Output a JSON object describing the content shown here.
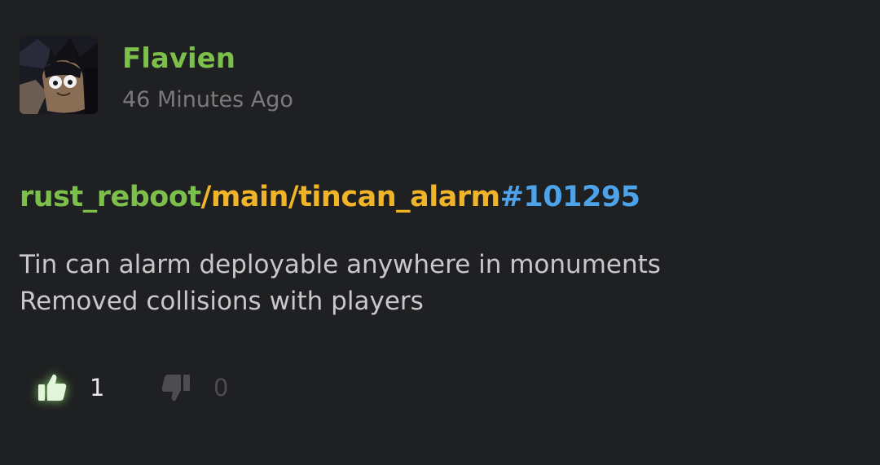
{
  "post": {
    "author": "Flavien",
    "timestamp": "46 Minutes Ago",
    "avatar_icon": "cartoon-avatar-icon",
    "commit": {
      "repo": "rust_reboot",
      "branch": "/main/tincan_alarm",
      "changeset": "#101295"
    },
    "message_lines": [
      "Tin can alarm deployable anywhere in monuments",
      "Removed collisions with players"
    ],
    "votes": {
      "up_icon": "thumbs-up-icon",
      "up_count": "1",
      "down_icon": "thumbs-down-icon",
      "down_count": "0"
    }
  },
  "colors": {
    "background": "#1f2022",
    "author": "#7cbf4a",
    "repo": "#7cbf4a",
    "branch": "#f0b429",
    "changeset": "#4da3ea",
    "message": "#c8c8ca",
    "timestamp": "#7a7a7c",
    "upvote_active": "#e2f5da",
    "downvote_inactive": "#4d4d50"
  }
}
